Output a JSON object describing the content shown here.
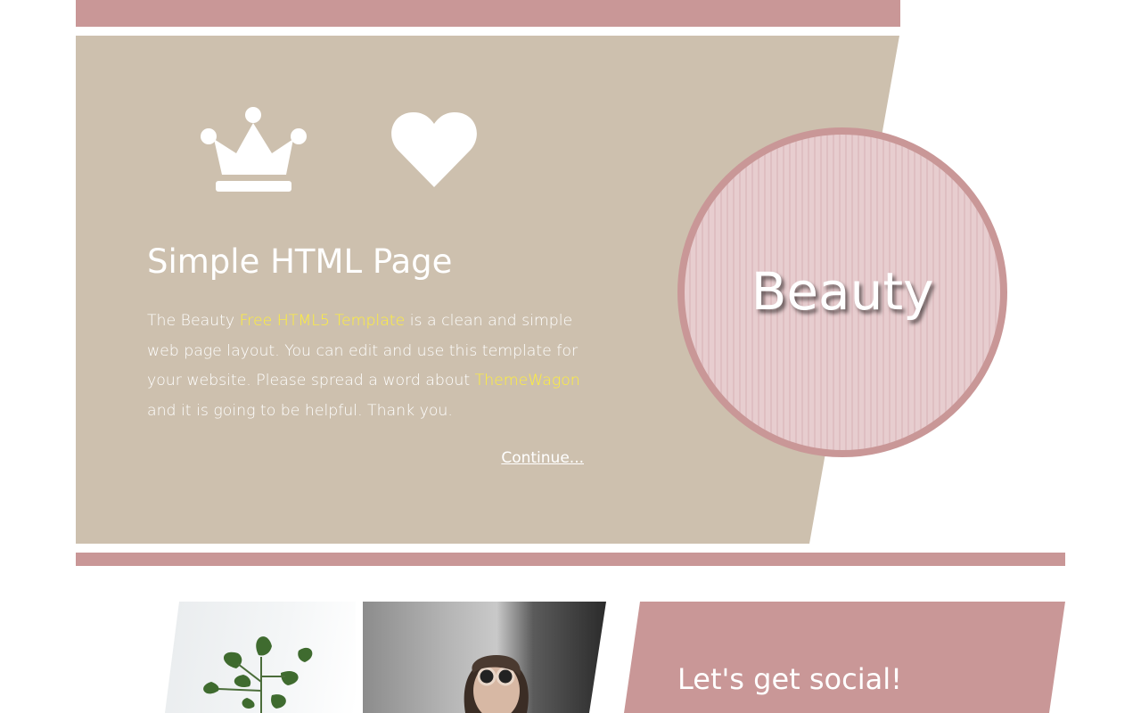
{
  "hero": {
    "title": "Simple HTML Page",
    "text_1": "The Beauty ",
    "link_template": "Free HTML5 Template",
    "text_2": " is a clean and simple web page layout. You can edit and use this template for your website. Please spread a word about ",
    "link_themewagon": "ThemeWagon",
    "text_3": " and it is going to be helpful. Thank you.",
    "continue_label": "Continue..."
  },
  "circle": {
    "label": "Beauty"
  },
  "social": {
    "title": "Let's get social!"
  },
  "icons": {
    "crown": "crown-icon",
    "heart": "heart-icon"
  },
  "colors": {
    "accent_pink": "#c99797",
    "hero_beige": "#cdc0ae",
    "link_yellow": "#ffef3a",
    "circle_fill": "#e7cdcf"
  }
}
